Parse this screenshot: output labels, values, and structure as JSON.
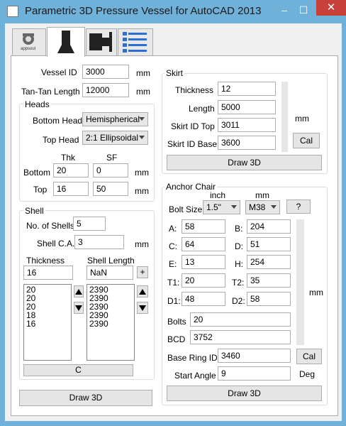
{
  "window": {
    "title": "Parametric 3D Pressure Vessel for AutoCAD 2013",
    "minimize": "–",
    "maximize": "☐",
    "close": "✕"
  },
  "tabs": [
    {
      "name": "appsoul",
      "label": "appsoul"
    },
    {
      "name": "vessel"
    },
    {
      "name": "nozzle"
    },
    {
      "name": "list"
    }
  ],
  "vessel": {
    "id_label": "Vessel ID",
    "id_value": "3000",
    "id_unit": "mm",
    "tt_label": "Tan-Tan Length",
    "tt_value": "12000",
    "tt_unit": "mm"
  },
  "heads": {
    "title": "Heads",
    "bottom_label": "Bottom Head",
    "bottom_value": "Hemispherical",
    "top_label": "Top Head",
    "top_value": "2:1 Ellipsoidal",
    "thk_header": "Thk",
    "sf_header": "SF",
    "row_bottom": "Bottom",
    "row_top": "Top",
    "bottom_thk": "20",
    "bottom_sf": "0",
    "top_thk": "16",
    "top_sf": "50",
    "unit1": "mm",
    "unit2": "mm"
  },
  "shell": {
    "title": "Shell",
    "num_label": "No. of Shells",
    "num_value": "5",
    "ca_label": "Shell C.A.",
    "ca_value": "3",
    "ca_unit": "mm",
    "thk_header": "Thickness",
    "len_header": "Shell Length",
    "thk_input": "16",
    "len_input": "NaN",
    "add_label": "+",
    "thicknesses": [
      "20",
      "20",
      "20",
      "18",
      "16"
    ],
    "lengths": [
      "2390",
      "2390",
      "2390",
      "2390",
      "2390"
    ],
    "c_button": "C"
  },
  "skirt": {
    "title": "Skirt",
    "thk_label": "Thickness",
    "thk_value": "12",
    "len_label": "Length",
    "len_value": "5000",
    "top_label": "Skirt ID Top",
    "top_value": "3011",
    "base_label": "Skirt ID Base",
    "base_value": "3600",
    "unit": "mm",
    "cal_button": "Cal",
    "draw_button": "Draw 3D"
  },
  "anchor": {
    "title": "Anchor Chair",
    "inch_label": "inch",
    "mm_label": "mm",
    "bolt_size_label": "Bolt Size",
    "bolt_inch": "1.5\"",
    "bolt_mm": "M38",
    "help_button": "?",
    "A_label": "A:",
    "A": "58",
    "B_label": "B:",
    "B": "204",
    "C_label": "C:",
    "C": "64",
    "D_label": "D:",
    "D": "51",
    "E_label": "E:",
    "E": "13",
    "H_label": "H:",
    "H": "254",
    "T1_label": "T1:",
    "T1": "20",
    "T2_label": "T2:",
    "T2": "35",
    "D1_label": "D1:",
    "D1": "48",
    "D2_label": "D2:",
    "D2": "58",
    "unit": "mm",
    "bolts_label": "Bolts",
    "bolts": "20",
    "bcd_label": "BCD",
    "bcd": "3752",
    "ring_label": "Base Ring ID",
    "ring": "3460",
    "cal_button": "Cal",
    "angle_label": "Start Angle",
    "angle": "9",
    "angle_unit": "Deg",
    "draw_button": "Draw 3D"
  },
  "main": {
    "draw_button": "Draw 3D"
  },
  "colors": {
    "titlebar": "#6fb1d8",
    "close": "#c9403a"
  }
}
